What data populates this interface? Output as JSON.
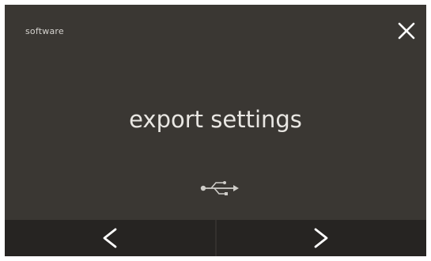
{
  "header": {
    "breadcrumb": "software",
    "close_icon": "close-icon"
  },
  "main": {
    "title": "export settings",
    "icon": "usb-icon"
  },
  "nav": {
    "prev_icon": "chevron-left-icon",
    "next_icon": "chevron-right-icon"
  },
  "colors": {
    "screen_background": "#3a3733",
    "nav_background": "#262422",
    "text": "#e9e7e3"
  }
}
